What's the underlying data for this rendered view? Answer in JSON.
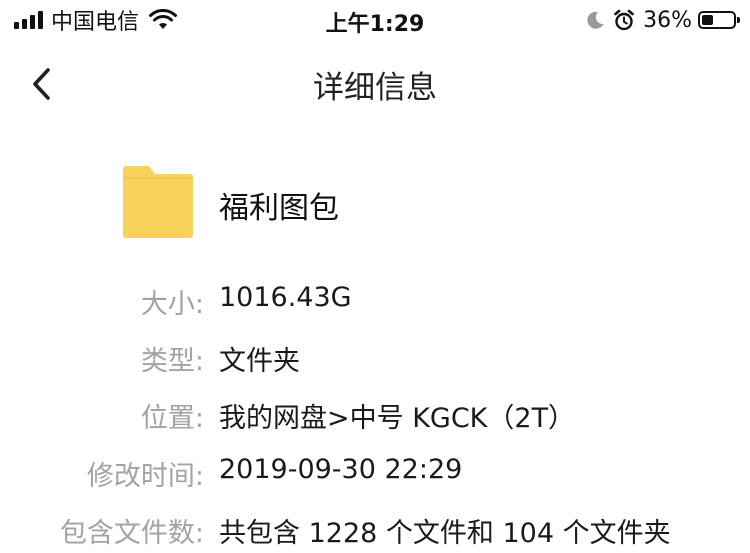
{
  "status_bar": {
    "carrier": "中国电信",
    "time": "上午1:29",
    "battery_percent": "36%",
    "battery_level": 0.36,
    "icons": [
      "signal-icon",
      "wifi-icon",
      "moon-icon",
      "alarm-icon",
      "battery-icon"
    ]
  },
  "nav": {
    "title": "详细信息",
    "back_icon": "chevron-left-icon"
  },
  "file": {
    "name": "福利图包",
    "icon": "folder-icon",
    "icon_color": "#f7d35c"
  },
  "details": {
    "size": {
      "label": "大小:",
      "value": "1016.43G"
    },
    "type": {
      "label": "类型:",
      "value": "文件夹"
    },
    "location": {
      "label": "位置:",
      "value": "我的网盘>中号 KGCK（2T）"
    },
    "modified": {
      "label": "修改时间:",
      "value": "2019-09-30 22:29"
    },
    "count": {
      "label": "包含文件数:",
      "value": "共包含 1228 个文件和 104 个文件夹"
    }
  },
  "colors": {
    "label": "#a3a3a3",
    "text": "#1a1a1a",
    "folder": "#f7d35c"
  }
}
